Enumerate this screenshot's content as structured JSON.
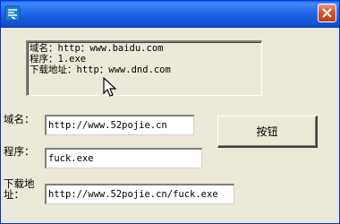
{
  "titlebar": {
    "app_icon": "app-logo-icon",
    "close_icon": "close-icon",
    "close_color": "#D6562F",
    "title_color": "#1C5FE0"
  },
  "memo": {
    "lines": [
      "域名：http：www.baidu.com",
      "程序：1.exe",
      "下载地址：http：www.dnd.com"
    ]
  },
  "form": {
    "domain_label": "域名：",
    "domain_value": "http://www.52pojie.cn",
    "program_label": "程序：",
    "program_value": "fuck.exe",
    "download_label_line1": "下载地",
    "download_label_line2": "址：",
    "download_value": "http://www.52pojie.cn/fuck.exe"
  },
  "button": {
    "label": "按钮"
  }
}
